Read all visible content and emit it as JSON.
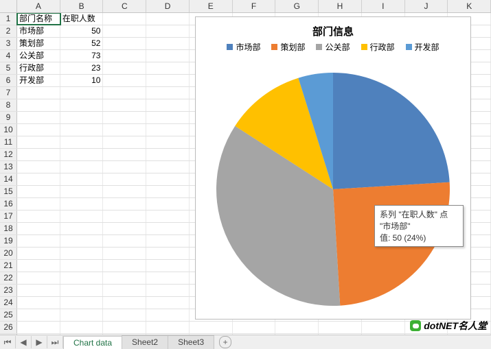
{
  "columns": [
    "A",
    "B",
    "C",
    "D",
    "E",
    "F",
    "G",
    "H",
    "I",
    "J",
    "K"
  ],
  "header": {
    "col_dept": "部门名称",
    "col_count": "在职人数"
  },
  "rows": [
    {
      "dept": "市场部",
      "count": 50
    },
    {
      "dept": "策划部",
      "count": 52
    },
    {
      "dept": "公关部",
      "count": 73
    },
    {
      "dept": "行政部",
      "count": 23
    },
    {
      "dept": "开发部",
      "count": 10
    }
  ],
  "selected_cell": "A1",
  "chart_data": {
    "type": "pie",
    "title": "部门信息",
    "categories": [
      "市场部",
      "策划部",
      "公关部",
      "行政部",
      "开发部"
    ],
    "values": [
      50,
      52,
      73,
      23,
      10
    ],
    "colors": [
      "#4F81BD",
      "#ED7D31",
      "#A5A5A5",
      "#FFC000",
      "#5B9BD5"
    ],
    "series_name": "在职人数"
  },
  "tooltip": {
    "line1": "系列 \"在职人数\" 点 \"市场部\"",
    "line2": "值: 50 (24%)"
  },
  "tabs": [
    {
      "label": "Chart data",
      "active": true
    },
    {
      "label": "Sheet2",
      "active": false
    },
    {
      "label": "Sheet3",
      "active": false
    }
  ],
  "brand": "dotNET名人堂"
}
